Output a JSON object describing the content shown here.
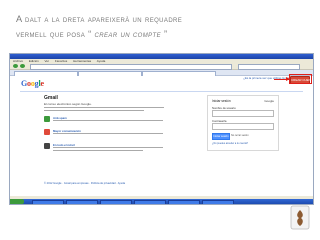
{
  "slide": {
    "title_line1": "A dalt a la dreta apareixerà un requadre",
    "title_line2_prefix": "vermell que posa “",
    "title_line2_italic": " crear un compte",
    "title_line2_suffix": " ”"
  },
  "browser": {
    "menu": [
      "Archivo",
      "Edición",
      "Ver",
      "Favoritos",
      "Herramientas",
      "Ayuda"
    ]
  },
  "google_bar": {
    "right_text": "¿Es la primera vez que utilizas Gmail?"
  },
  "create_account_button": {
    "label": "CREAR CUENTA"
  },
  "logo": {
    "letters": [
      "G",
      "o",
      "o",
      "g",
      "l",
      "e"
    ]
  },
  "gmail_section": {
    "title": "Gmail",
    "subtitle": "El correo electrónico según Google.",
    "features": [
      {
        "title": "Anti-spam",
        "color": "#3c9a3c"
      },
      {
        "title": "Mayor comunicación",
        "color": "#e04a3a"
      },
      {
        "title": "En todo el móvil",
        "color": "#444444"
      }
    ]
  },
  "signin_box": {
    "header": "Iniciar sesión",
    "brand": "Google",
    "email_label": "Nombre de usuario",
    "password_label": "Contraseña",
    "signin_button": "Iniciar sesión",
    "keep_label": "No cerrar sesión",
    "help_link": "¿No puedes acceder a tu cuenta?"
  },
  "footer": {
    "links": [
      "© 2012 Google",
      "Gmail para empresas",
      "Política de privacidad",
      "Ayuda"
    ]
  },
  "colors": {
    "title_text": "#7a7a7a",
    "highlight_red": "#e0201a",
    "create_button": "#d84a38"
  }
}
